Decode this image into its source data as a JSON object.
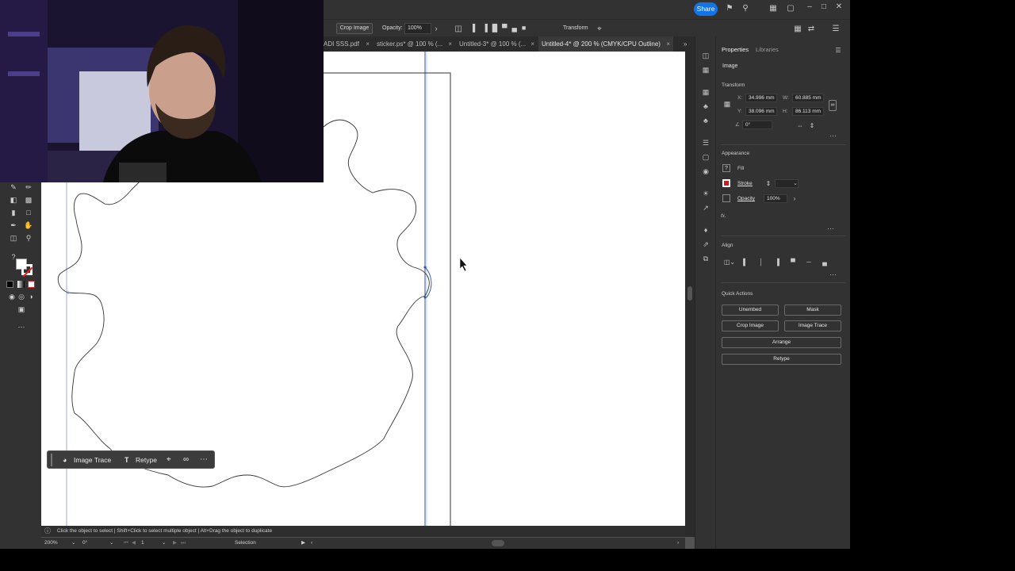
{
  "topbar": {
    "share_label": "Share",
    "icons": [
      "bell-icon",
      "search-icon",
      "arrange-docs-icon",
      "workspace-icon",
      "minimize-icon",
      "maximize-icon",
      "close-icon"
    ]
  },
  "control_bar": {
    "crop_label": "Crop Image",
    "opacity_label": "Opacity:",
    "opacity_value": "100%",
    "transform_label": "Transform"
  },
  "tabs": [
    {
      "label": "ADI SSS.pdf",
      "close": "×"
    },
    {
      "label": "sticker.ps* @ 100 % (...",
      "close": "×"
    },
    {
      "label": "Untitled-3* @ 100 % (...",
      "close": "×"
    },
    {
      "label": "Untitled-4* @ 200 % (CMYK/CPU Outline)",
      "close": "×",
      "active": true
    }
  ],
  "tab_overflow": "»",
  "panel": {
    "tab_properties": "Properties",
    "tab_libraries": "Libraries",
    "object_type": "Image",
    "transform_title": "Transform",
    "x_label": "X:",
    "x_value": "34.996 mm",
    "w_label": "W:",
    "w_value": "60.885 mm",
    "y_label": "Y:",
    "y_value": "38.096 mm",
    "h_label": "H:",
    "h_value": "86.113 mm",
    "angle_value": "0°",
    "appearance_title": "Appearance",
    "fill_label": "Fill",
    "stroke_label": "Stroke",
    "opacity_label": "Opacity",
    "opacity_value": "100%",
    "fx_label": "fx.",
    "align_title": "Align",
    "quick_actions_title": "Quick Actions",
    "btn_unembed": "Unembed",
    "btn_mask": "Mask",
    "btn_crop": "Crop Image",
    "btn_image_trace": "Image Trace",
    "btn_arrange": "Arrange",
    "btn_retype": "Retype"
  },
  "context_bar": {
    "image_trace": "Image Trace",
    "retype": "Retype"
  },
  "status": {
    "hint": "Click the object to select  |  Shift+Click to select multiple object  |  Alt+Drag the object to duplicate",
    "zoom": "200%",
    "rotation": "0°",
    "artboard": "1",
    "tool": "Selection"
  },
  "colors": {
    "accent": "#1473e6",
    "chrome_dark": "#323232",
    "canvas": "#ffffff",
    "outline": "#3a3a3a",
    "guide": "#2a4f9a"
  }
}
